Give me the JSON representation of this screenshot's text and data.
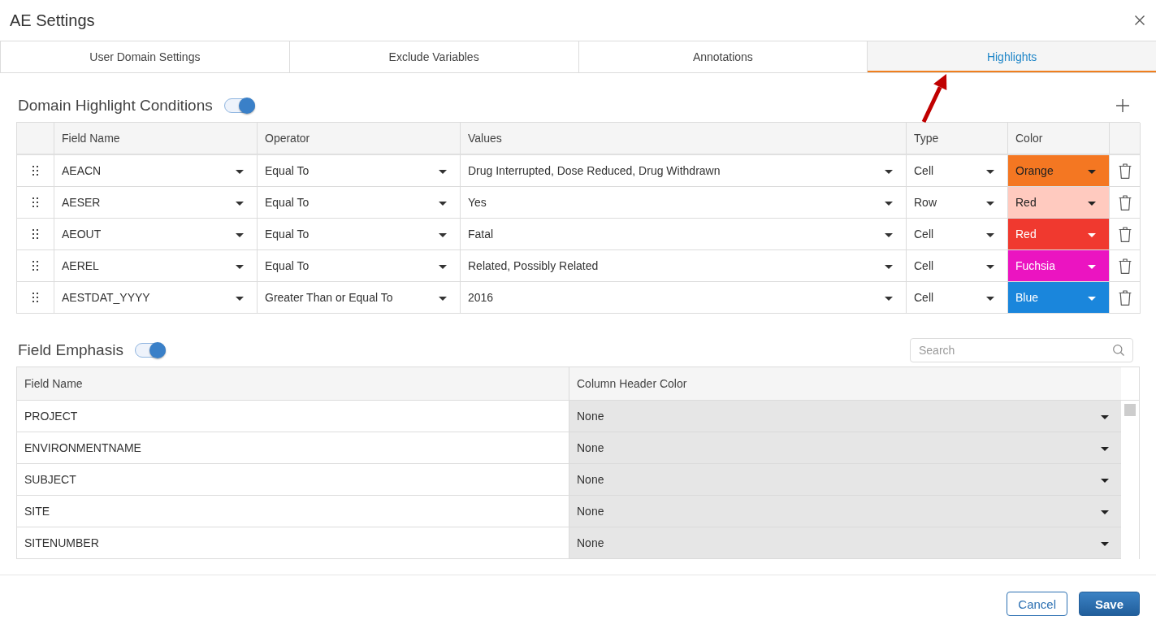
{
  "dialog": {
    "title": "AE Settings"
  },
  "tabs": [
    {
      "label": "User Domain Settings",
      "selected": false
    },
    {
      "label": "Exclude Variables",
      "selected": false
    },
    {
      "label": "Annotations",
      "selected": false
    },
    {
      "label": "Highlights",
      "selected": true
    }
  ],
  "domain_highlight_conditions": {
    "title": "Domain Highlight Conditions",
    "enabled": true,
    "columns": [
      "Field Name",
      "Operator",
      "Values",
      "Type",
      "Color"
    ],
    "rows": [
      {
        "field_name": "AEACN",
        "operator": "Equal To",
        "values": "Drug Interrupted, Dose Reduced, Drug Withdrawn",
        "type": "Cell",
        "color_name": "Orange",
        "color": "#f47722"
      },
      {
        "field_name": "AESER",
        "operator": "Equal To",
        "values": "Yes",
        "type": "Row",
        "color_name": "Red",
        "color": "#ffcabf"
      },
      {
        "field_name": "AEOUT",
        "operator": "Equal To",
        "values": "Fatal",
        "type": "Cell",
        "color_name": "Red",
        "color": "#f0392f"
      },
      {
        "field_name": "AEREL",
        "operator": "Equal To",
        "values": "Related, Possibly Related",
        "type": "Cell",
        "color_name": "Fuchsia",
        "color": "#eb14c1"
      },
      {
        "field_name": "AESTDAT_YYYY",
        "operator": "Greater Than or Equal To",
        "values": "2016",
        "type": "Cell",
        "color_name": "Blue",
        "color": "#1a86dc"
      }
    ]
  },
  "field_emphasis": {
    "title": "Field Emphasis",
    "enabled": true,
    "search": {
      "placeholder": "Search"
    },
    "columns": [
      "Field Name",
      "Column Header Color"
    ],
    "rows": [
      {
        "field_name": "PROJECT",
        "header_color": "None"
      },
      {
        "field_name": "ENVIRONMENTNAME",
        "header_color": "None"
      },
      {
        "field_name": "SUBJECT",
        "header_color": "None"
      },
      {
        "field_name": "SITE",
        "header_color": "None"
      },
      {
        "field_name": "SITENUMBER",
        "header_color": "None"
      }
    ]
  },
  "buttons": [
    {
      "label": "Cancel",
      "kind": "secondary"
    },
    {
      "label": "Save",
      "kind": "primary"
    }
  ]
}
